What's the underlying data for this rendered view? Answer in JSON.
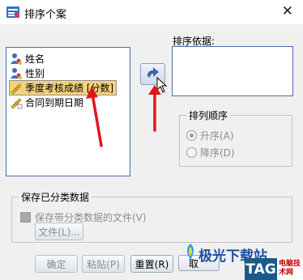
{
  "window": {
    "title": "排序个案",
    "close_symbol": "✕"
  },
  "variables": {
    "items": [
      {
        "label": "姓名",
        "icon": "nominal-person-icon",
        "selected": false
      },
      {
        "label": "性别",
        "icon": "nominal-person-icon",
        "selected": false
      },
      {
        "label": "季度考核成绩 [分数]",
        "icon": "scale-ruler-icon",
        "selected": true
      },
      {
        "label": "合同到期日期",
        "icon": "scale-ruler-icon",
        "selected": false
      }
    ]
  },
  "sort_by": {
    "label": "排序依据:"
  },
  "sort_order": {
    "title": "排列顺序",
    "ascending": "升序(A)",
    "descending": "降序(D)",
    "selected": "ascending"
  },
  "save_sorted": {
    "title": "保存已分类数据",
    "checkbox_label": "保存带分类数据的文件(V)",
    "file_button": "文件(L)..."
  },
  "buttons": {
    "ok": "确定",
    "paste": "粘贴(P)",
    "reset": "重置(R)",
    "cancel": "取"
  },
  "watermark": {
    "main": "极光下载站",
    "tag": "TAG",
    "tag_caption": "电脑技术网"
  },
  "colors": {
    "selection": "#f6d17b",
    "list_border": "#4a6ea9",
    "annotation_arrow": "#e0161b"
  }
}
